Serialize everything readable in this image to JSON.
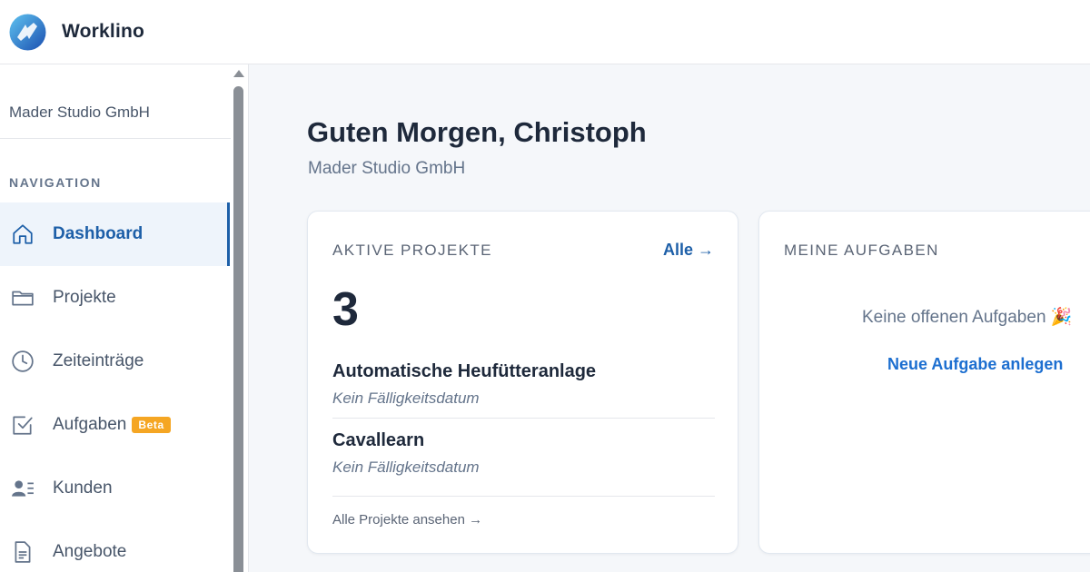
{
  "app": {
    "name": "Worklino",
    "logo_icon": "worklino-logo-icon"
  },
  "sidebar": {
    "organization": "Mader Studio GmbH",
    "nav_heading": "NAVIGATION",
    "items": [
      {
        "label": "Dashboard",
        "icon": "home-icon",
        "active": true
      },
      {
        "label": "Projekte",
        "icon": "folder-icon"
      },
      {
        "label": "Zeiteinträge",
        "icon": "clock-icon"
      },
      {
        "label": "Aufgaben",
        "icon": "checkbox-icon",
        "badge": "Beta"
      },
      {
        "label": "Kunden",
        "icon": "contacts-icon"
      },
      {
        "label": "Angebote",
        "icon": "document-icon"
      }
    ]
  },
  "main": {
    "greeting": "Guten Morgen, Christoph",
    "subtitle": "Mader Studio GmbH",
    "projects_card": {
      "title": "AKTIVE PROJEKTE",
      "link": "Alle →",
      "count": "3",
      "projects": [
        {
          "name": "Automatische Heufütteranlage",
          "due": "Kein Fälligkeitsdatum"
        },
        {
          "name": "Cavallearn",
          "due": "Kein Fälligkeitsdatum"
        }
      ],
      "footer_link": "Alle Projekte ansehen →"
    },
    "tasks_card": {
      "title": "MEINE AUFGABEN",
      "empty_text": "Keine offenen Aufgaben 🎉",
      "new_task_link": "Neue Aufgabe anlegen"
    }
  },
  "colors": {
    "accent": "#1d5fa8",
    "link": "#1d6fd0",
    "badge": "#f5a623",
    "background": "#f5f7fa",
    "text": "#1e293b"
  }
}
